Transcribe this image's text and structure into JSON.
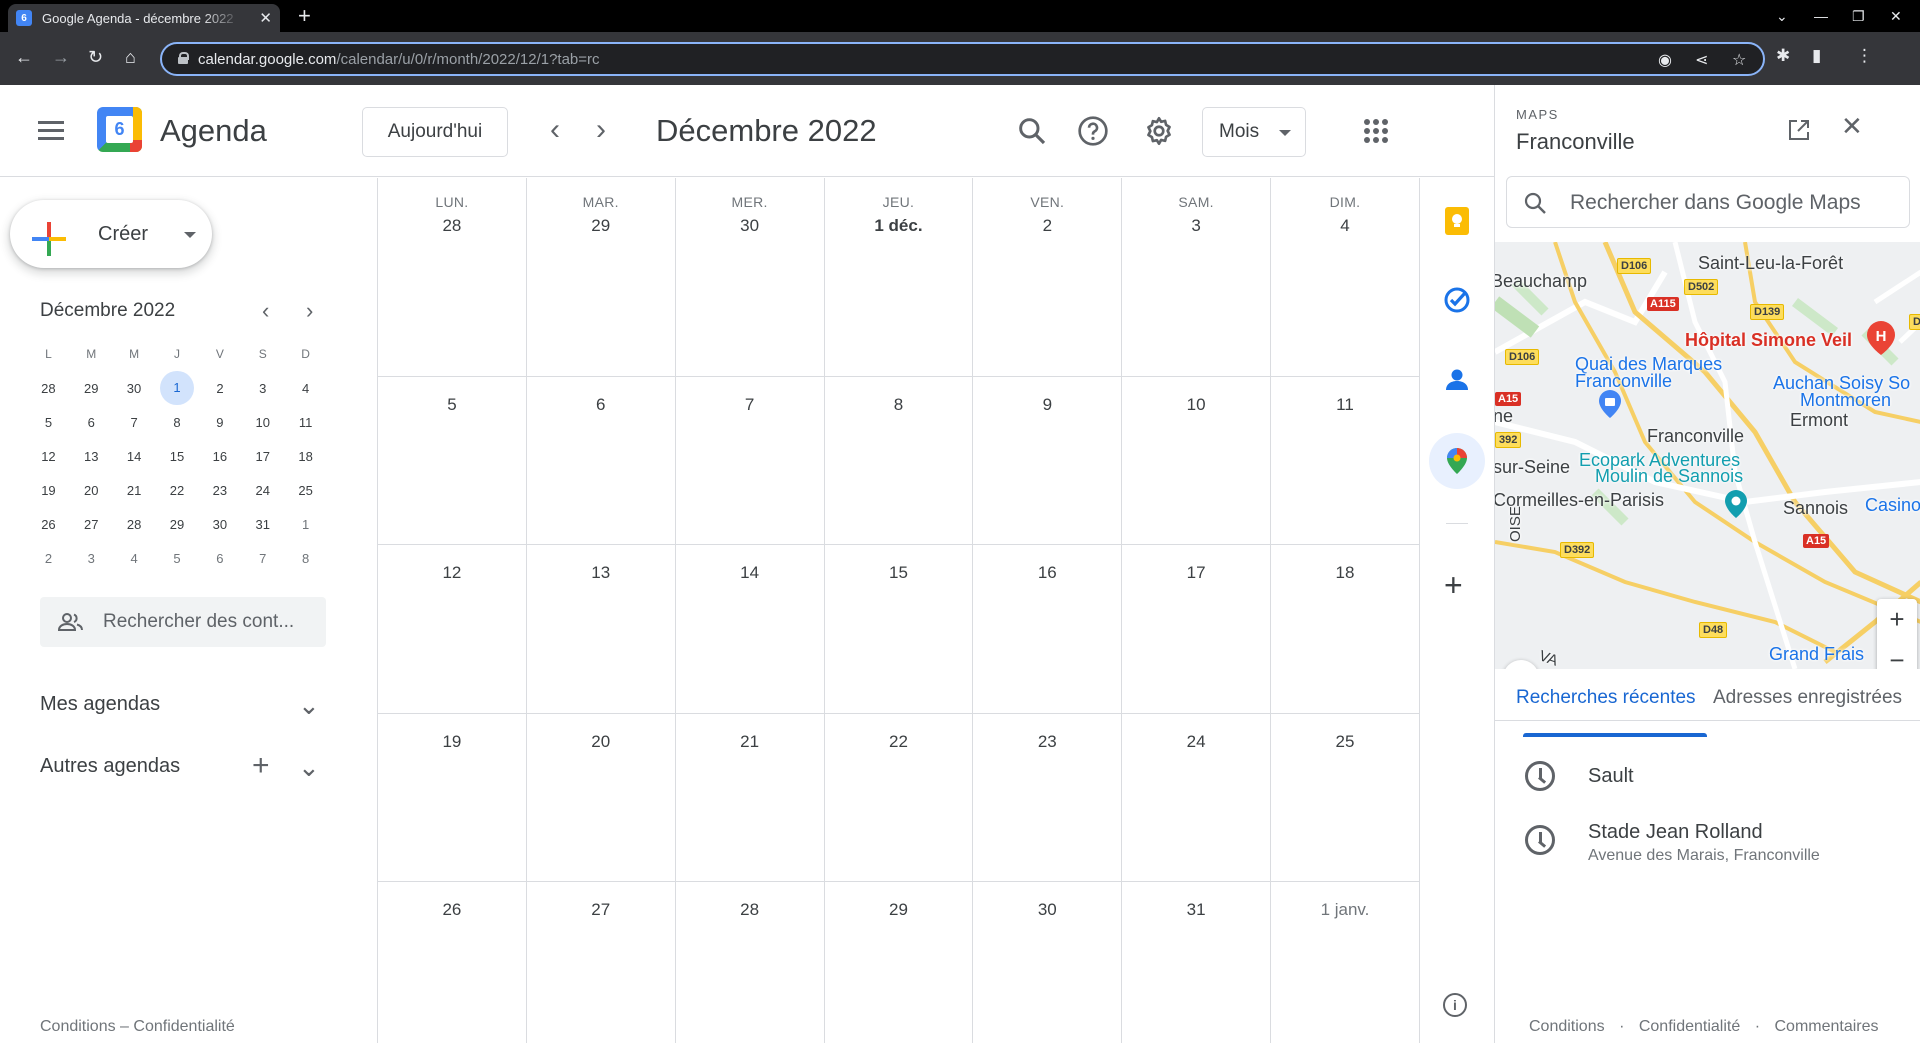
{
  "browser": {
    "tab_title": "Google Agenda - décembre 2022",
    "favicon_text": "6",
    "url_host": "calendar.google.com",
    "url_path": "/calendar/u/0/r/month/2022/12/1?tab=rc"
  },
  "header": {
    "app_name": "Agenda",
    "logo_day": "6",
    "today_label": "Aujourd'hui",
    "month_title": "Décembre 2022",
    "view_label": "Mois"
  },
  "sidebar": {
    "create_label": "Créer",
    "mini_title": "Décembre 2022",
    "mini_weekdays": [
      "L",
      "M",
      "M",
      "J",
      "V",
      "S",
      "D"
    ],
    "mini_weeks": [
      [
        "28",
        "29",
        "30",
        "1",
        "2",
        "3",
        "4"
      ],
      [
        "5",
        "6",
        "7",
        "8",
        "9",
        "10",
        "11"
      ],
      [
        "12",
        "13",
        "14",
        "15",
        "16",
        "17",
        "18"
      ],
      [
        "19",
        "20",
        "21",
        "22",
        "23",
        "24",
        "25"
      ],
      [
        "26",
        "27",
        "28",
        "29",
        "30",
        "31",
        "1"
      ],
      [
        "2",
        "3",
        "4",
        "5",
        "6",
        "7",
        "8"
      ]
    ],
    "contact_search_placeholder": "Rechercher des cont...",
    "my_calendars": "Mes agendas",
    "other_calendars": "Autres agendas",
    "footer": "Conditions – Confidentialité"
  },
  "month": {
    "weekdays": [
      "LUN.",
      "MAR.",
      "MER.",
      "JEU.",
      "VEN.",
      "SAM.",
      "DIM."
    ],
    "weeks": [
      [
        "28",
        "29",
        "30",
        "1 déc.",
        "2",
        "3",
        "4"
      ],
      [
        "5",
        "6",
        "7",
        "8",
        "9",
        "10",
        "11"
      ],
      [
        "12",
        "13",
        "14",
        "15",
        "16",
        "17",
        "18"
      ],
      [
        "19",
        "20",
        "21",
        "22",
        "23",
        "24",
        "25"
      ],
      [
        "26",
        "27",
        "28",
        "29",
        "30",
        "31",
        "1 janv."
      ]
    ]
  },
  "maps": {
    "label": "MAPS",
    "place": "Franconville",
    "search_placeholder": "Rechercher dans Google Maps",
    "map_labels": {
      "saint_leu": "Saint-Leu-la-Forêt",
      "beauchamp": "Beauchamp",
      "hopital": "Hôpital Simone Veil",
      "quai": "Quai des Marques",
      "quai2": "Franconville",
      "auchan": "Auchan Soisy So",
      "auchan2": "Montmoren",
      "ermont": "Ermont",
      "ne": "ne",
      "franconville": "Franconville",
      "ecopark": "Ecopark Adventures",
      "moulin": "Moulin de Sannois",
      "sur_seine": "sur-Seine",
      "cormeilles": "Cormeilles-en-Parisis",
      "sannois": "Sannois",
      "casino": "Casino",
      "grand_frais": "Grand Frais",
      "oise": "OISE",
      "va": "VA"
    },
    "roads": {
      "d106a": "D106",
      "d502": "D502",
      "a115": "A115",
      "d139": "D139",
      "d106b": "D106",
      "a15a": "A15",
      "d392a": "392",
      "d392b": "D392",
      "a15b": "A15",
      "d48": "D48",
      "dcut": "D"
    },
    "tabs": [
      "Recherches récentes",
      "Adresses enregistrées"
    ],
    "recent": [
      {
        "name": "Sault",
        "address": ""
      },
      {
        "name": "Stade Jean Rolland",
        "address": "Avenue des Marais, Franconville"
      }
    ],
    "footer": [
      "Conditions",
      "·",
      "Confidentialité",
      "·",
      "Commentaires"
    ]
  }
}
